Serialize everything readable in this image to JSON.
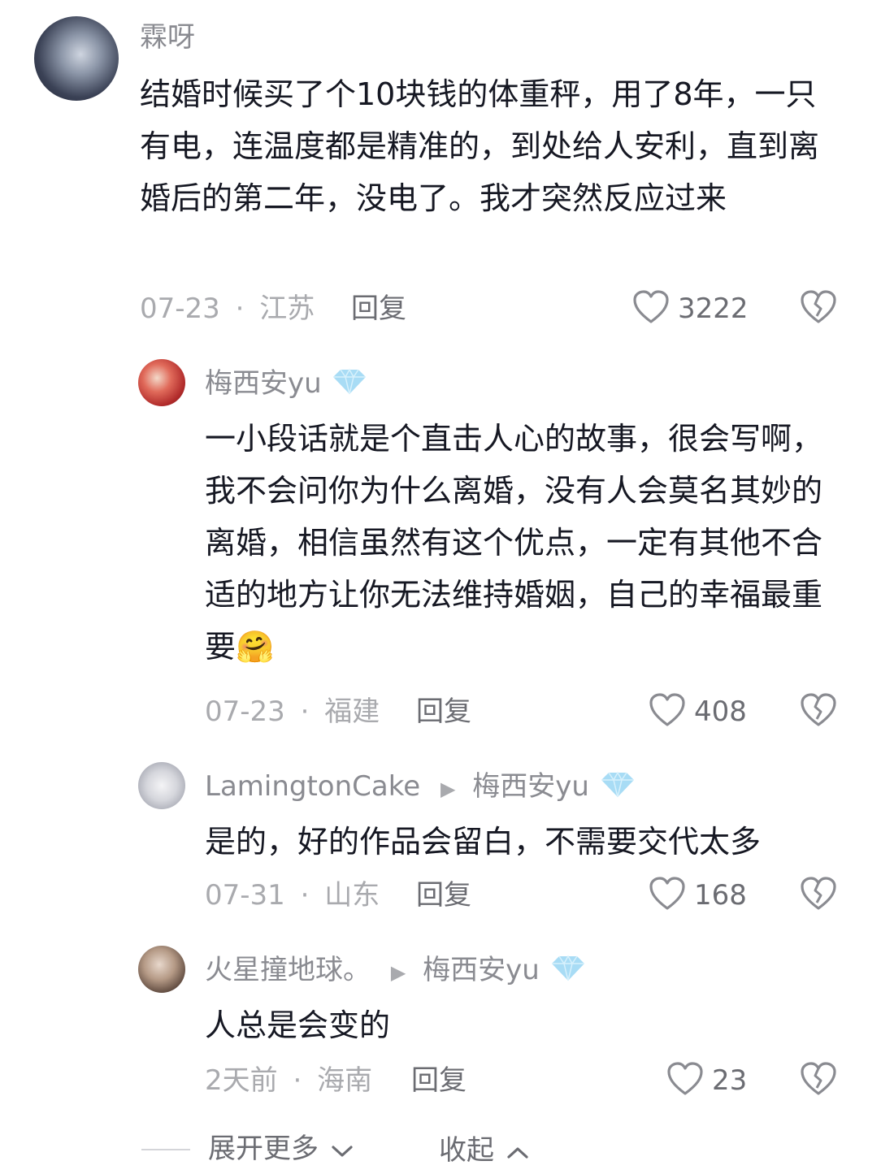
{
  "comments": [
    {
      "author": "霖呀",
      "text": "结婚时候买了个10块钱的体重秤，用了8年，一只有电，连温度都是精准的，到处给人安利，直到离婚后的第二年，没电了。我才突然反应过来",
      "date": "07-23",
      "location": "江苏",
      "reply_label": "回复",
      "likes": "3222"
    }
  ],
  "replies": [
    {
      "author": "梅西安yu",
      "text": "一小段话就是个直击人心的故事，很会写啊，我不会问你为什么离婚，没有人会莫名其妙的离婚，相信虽然有这个优点，一定有其他不合适的地方让你无法维持婚姻，自己的幸福最重要",
      "emoji": "🤗",
      "date": "07-23",
      "location": "福建",
      "reply_label": "回复",
      "likes": "408"
    },
    {
      "author": "LamingtonCake",
      "reply_to": "梅西安yu",
      "text": "是的，好的作品会留白，不需要交代太多",
      "date": "07-31",
      "location": "山东",
      "reply_label": "回复",
      "likes": "168"
    },
    {
      "author": "火星撞地球。",
      "reply_to": "梅西安yu",
      "text": "人总是会变的",
      "date": "2天前",
      "location": "海南",
      "reply_label": "回复",
      "likes": "23"
    }
  ],
  "footer": {
    "expand_label": "展开更多",
    "collapse_label": "收起"
  },
  "separator": "·",
  "colors": {
    "text": "#161823",
    "secondary": "#a9aaae",
    "diamond": "#9fd8f5"
  }
}
